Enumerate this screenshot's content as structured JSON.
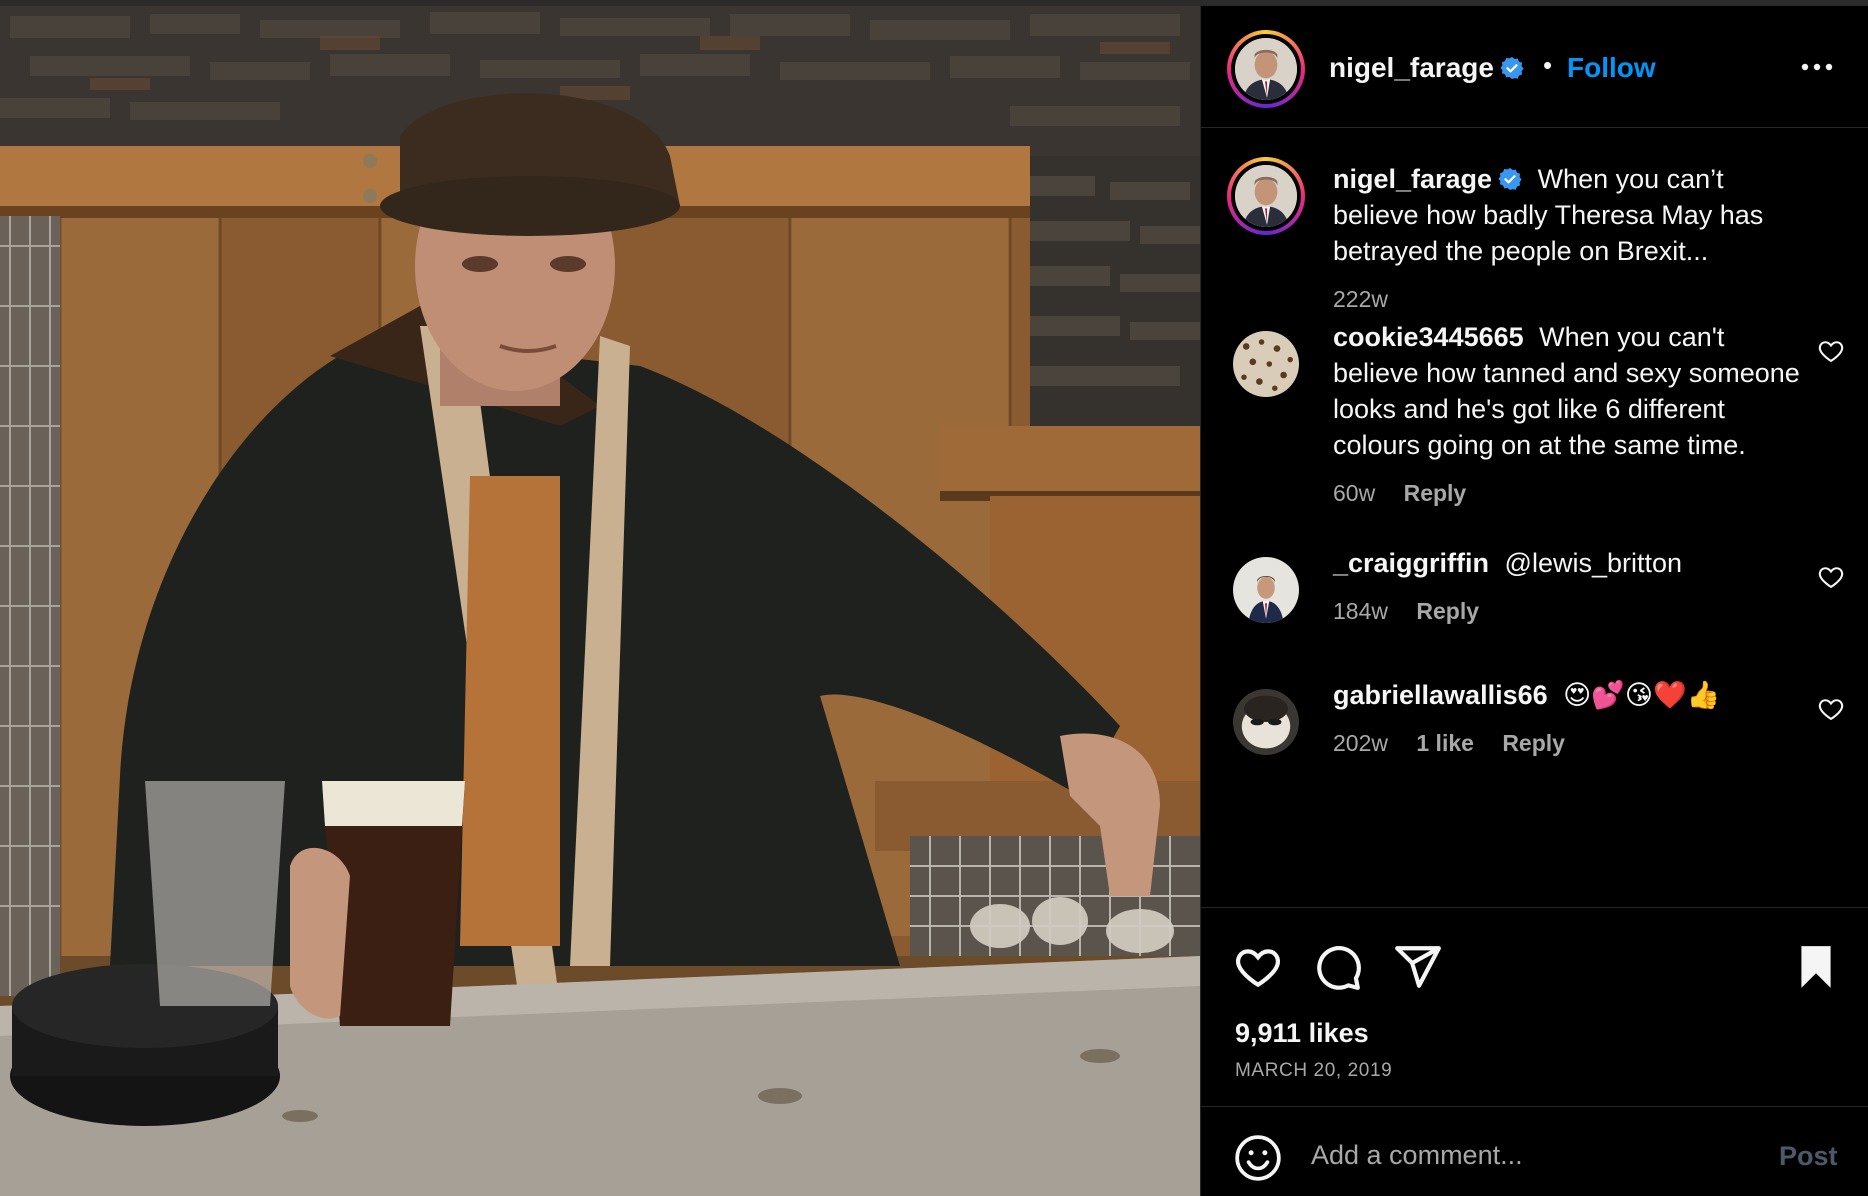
{
  "post": {
    "author": "nigel_farage",
    "header_separator": "•",
    "follow_label": "Follow",
    "photo_alt": "Man in flat cap and waxed jacket sitting at a table with a pint of beer"
  },
  "comments": [
    {
      "username": "nigel_farage",
      "verified": true,
      "text": "When you can’t believe how badly Theresa May has betrayed the people on Brexit...",
      "time": "222w",
      "is_caption": true
    },
    {
      "username": "cookie3445665",
      "text": "When you can't believe how tanned and sexy someone looks and he's got like 6 different colours going on at the same time.",
      "time": "60w",
      "reply_label": "Reply"
    },
    {
      "username": "_craiggriffin",
      "text": "@lewis_britton",
      "time": "184w",
      "reply_label": "Reply"
    },
    {
      "username": "gabriellawallis66",
      "text": "😍💕😘❤️👍",
      "time": "202w",
      "likes": "1 like",
      "reply_label": "Reply"
    }
  ],
  "footer": {
    "likes": "9,911 likes",
    "date": "MARCH 20, 2019",
    "comment_placeholder": "Add a comment...",
    "post_label": "Post"
  },
  "colors": {
    "accent": "#0095f6",
    "background": "#000000",
    "secondary_text": "#a8a8a8",
    "verified": "#3897f0"
  },
  "icons": [
    "heart-icon",
    "comment-icon",
    "share-icon",
    "bookmark-icon",
    "more-icon",
    "emoji-icon",
    "verified-badge-icon"
  ]
}
